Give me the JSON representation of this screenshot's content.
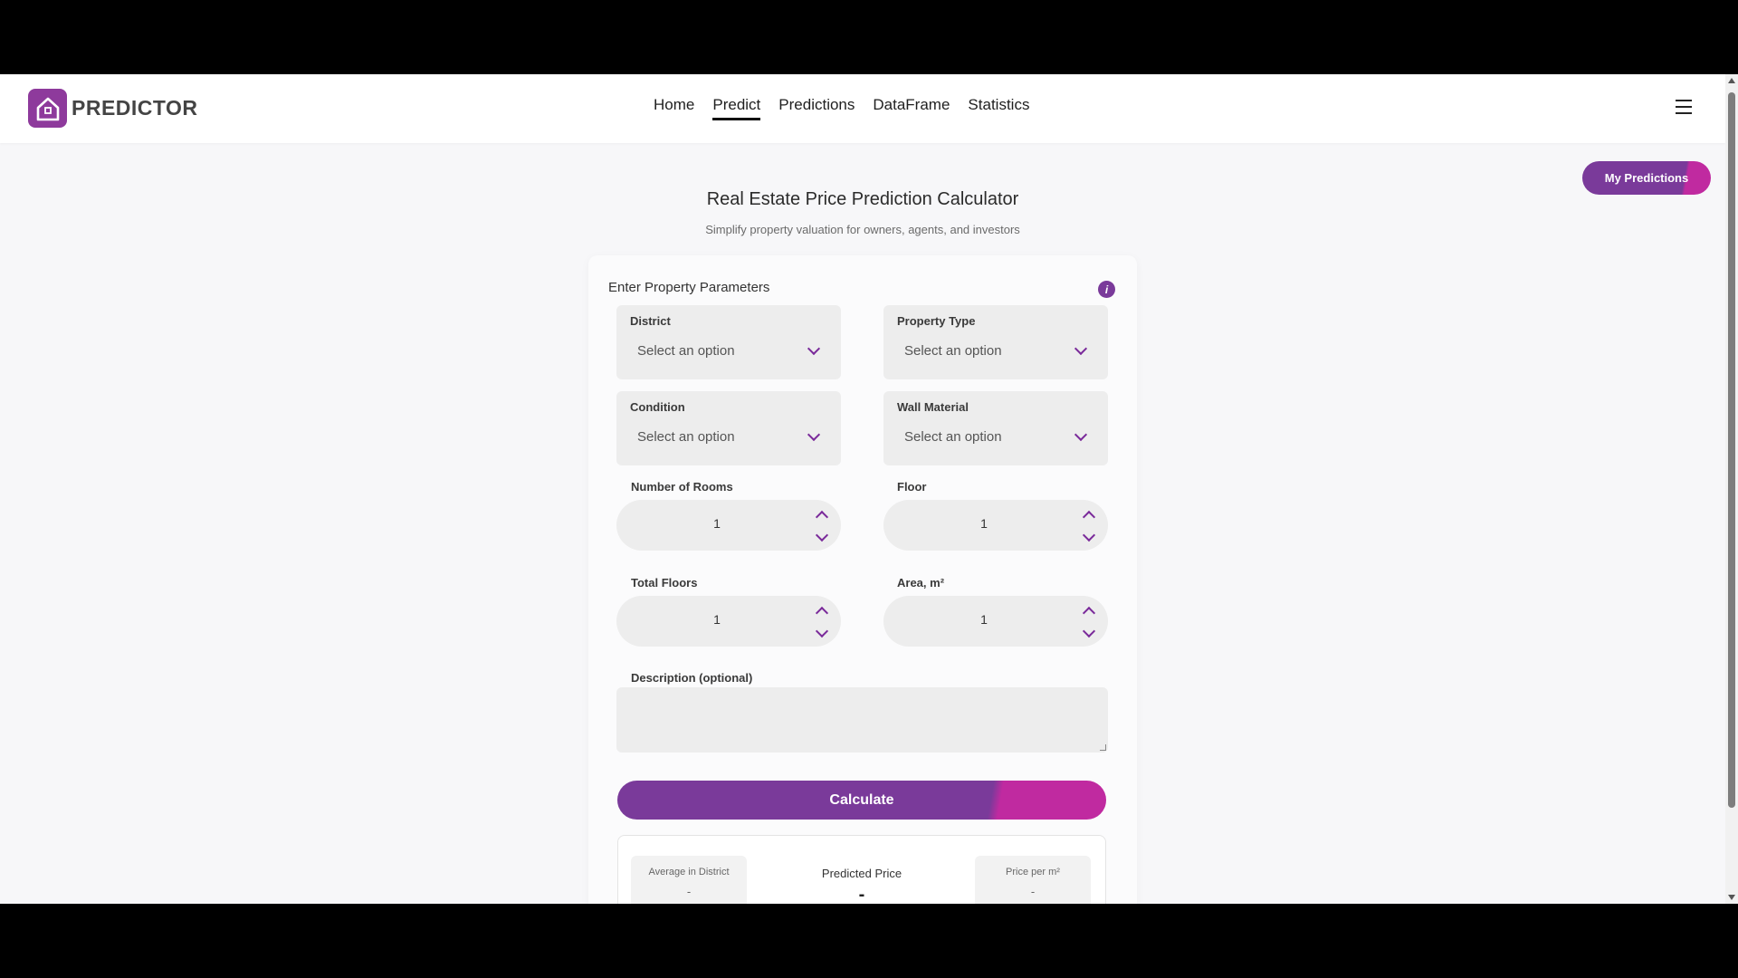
{
  "brand": {
    "name": "PREDICTOR",
    "accent": "#7a3a9a",
    "accent2": "#c02aa0"
  },
  "nav": {
    "items": [
      {
        "label": "Home"
      },
      {
        "label": "Predict",
        "active": true
      },
      {
        "label": "Predictions"
      },
      {
        "label": "DataFrame"
      },
      {
        "label": "Statistics"
      }
    ]
  },
  "my_predictions_label": "My Predictions",
  "page": {
    "title": "Real Estate Price Prediction Calculator",
    "subtitle": "Simplify property valuation for owners, agents, and investors"
  },
  "form": {
    "title": "Enter Property Parameters",
    "info_glyph": "i",
    "district": {
      "label": "District",
      "value": "Select an option"
    },
    "property_type": {
      "label": "Property Type",
      "value": "Select an option"
    },
    "condition": {
      "label": "Condition",
      "value": "Select an option"
    },
    "wall_material": {
      "label": "Wall Material",
      "value": "Select an option"
    },
    "rooms": {
      "label": "Number of Rooms",
      "value": "1"
    },
    "floor": {
      "label": "Floor",
      "value": "1"
    },
    "total_floors": {
      "label": "Total Floors",
      "value": "1"
    },
    "area": {
      "label": "Area, m²",
      "value": "1"
    },
    "description": {
      "label": "Description (optional)",
      "value": ""
    },
    "calculate_label": "Calculate"
  },
  "result": {
    "avg_label": "Average in District",
    "avg_value": "-",
    "predicted_label": "Predicted Price",
    "predicted_value": "-",
    "ppm_label": "Price per m²",
    "ppm_value": "-"
  }
}
